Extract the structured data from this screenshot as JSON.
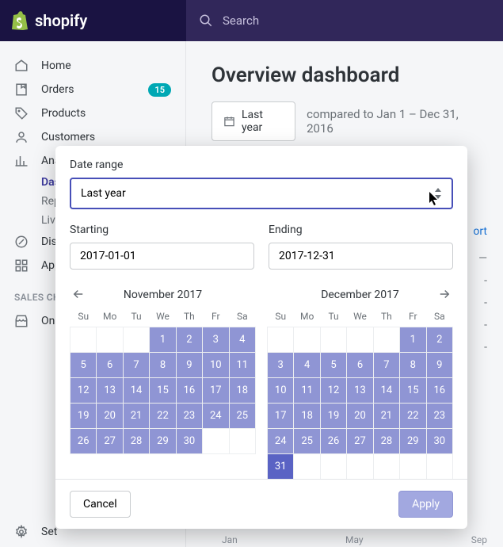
{
  "brand": "shopify",
  "search": {
    "placeholder": "Search"
  },
  "nav": {
    "home": "Home",
    "orders": "Orders",
    "orders_badge": "15",
    "products": "Products",
    "customers": "Customers",
    "analytics": "Ana",
    "sub_dash": "Das",
    "sub_reports": "Rep",
    "sub_live": "Live",
    "discounts": "Dis",
    "apps": "App",
    "sales_channels": "SALES CH",
    "online": "Onl",
    "settings": "Set"
  },
  "page": {
    "title": "Overview dashboard",
    "range_button": "Last year",
    "compared": "compared to Jan 1 – Dec 31, 2016",
    "report_link": "ort"
  },
  "popover": {
    "date_range_label": "Date range",
    "select_value": "Last year",
    "starting_label": "Starting",
    "ending_label": "Ending",
    "start_value": "2017-01-01",
    "end_value": "2017-12-31",
    "cancel": "Cancel",
    "apply": "Apply",
    "cal1": {
      "title": "November 2017",
      "dow": [
        "Su",
        "Mo",
        "Tu",
        "We",
        "Th",
        "Fr",
        "Sa"
      ],
      "lead_empty": 3,
      "days": 30
    },
    "cal2": {
      "title": "December 2017",
      "dow": [
        "Su",
        "Mo",
        "Tu",
        "We",
        "Th",
        "Fr",
        "Sa"
      ],
      "lead_empty": 5,
      "days": 31
    }
  },
  "axis_months": [
    "Jan",
    "May",
    "Sep"
  ]
}
